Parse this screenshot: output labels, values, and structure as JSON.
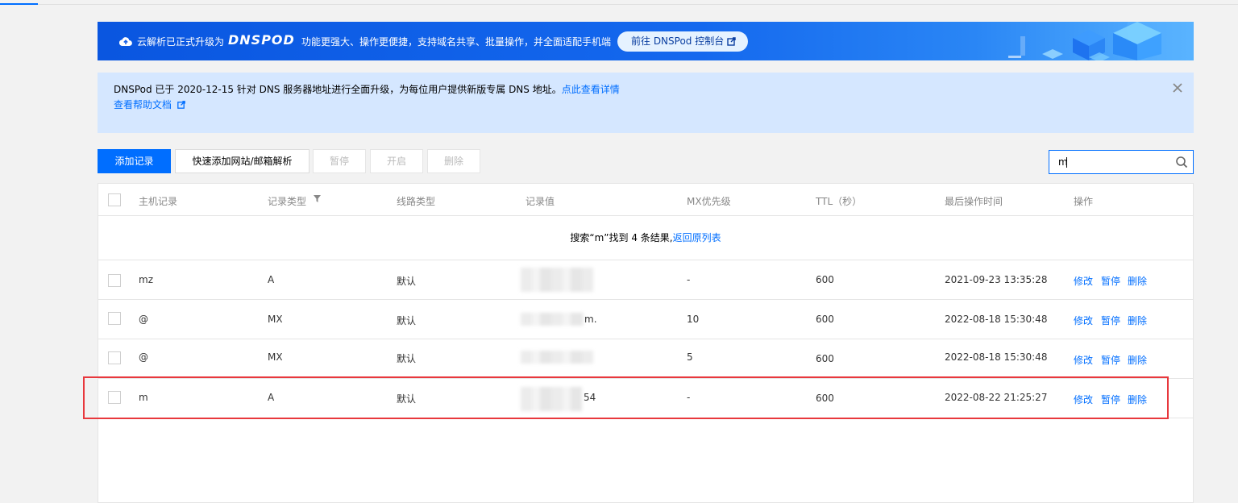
{
  "banner": {
    "lead": "云解析已正式升级为",
    "logo": "DNSPOD",
    "desc": "功能更强大、操作更便捷，支持域名共享、批量操作，并全面适配手机端",
    "cta": "前往 DNSPod 控制台"
  },
  "notice": {
    "text": "DNSPod 已于 2020-12-15 针对 DNS 服务器地址进行全面升级，为每位用户提供新版专属 DNS 地址。",
    "link": "点此查看详情",
    "help": "查看帮助文档"
  },
  "toolbar": {
    "add": "添加记录",
    "quick_add": "快速添加网站/邮箱解析",
    "pause": "暂停",
    "enable": "开启",
    "delete": "删除"
  },
  "search": {
    "value": "m"
  },
  "table": {
    "headers": {
      "host": "主机记录",
      "type": "记录类型",
      "line": "线路类型",
      "value": "记录值",
      "mx": "MX优先级",
      "ttl": "TTL（秒）",
      "time": "最后操作时间",
      "ops": "操作"
    },
    "search_info": "搜索“m”找到 4 条结果,",
    "back_link": "返回原列表",
    "rows": [
      {
        "host": "mz",
        "type": "A",
        "line": "默认",
        "value_suffix": "",
        "mx": "-",
        "ttl": "600",
        "time": "2021-09-23 13:35:28"
      },
      {
        "host": "@",
        "type": "MX",
        "line": "默认",
        "value_suffix": "m.",
        "mx": "10",
        "ttl": "600",
        "time": "2022-08-18 15:30:48"
      },
      {
        "host": "@",
        "type": "MX",
        "line": "默认",
        "value_suffix": "",
        "mx": "5",
        "ttl": "600",
        "time": "2022-08-18 15:30:48"
      },
      {
        "host": "m",
        "type": "A",
        "line": "默认",
        "value_suffix": "54",
        "mx": "-",
        "ttl": "600",
        "time": "2022-08-22 21:25:27"
      }
    ],
    "ops": {
      "edit": "修改",
      "pause": "暂停",
      "delete": "删除"
    }
  },
  "colors": {
    "accent": "#006eff",
    "highlight": "#e8383d",
    "notice_bg": "#d5e7ff"
  }
}
